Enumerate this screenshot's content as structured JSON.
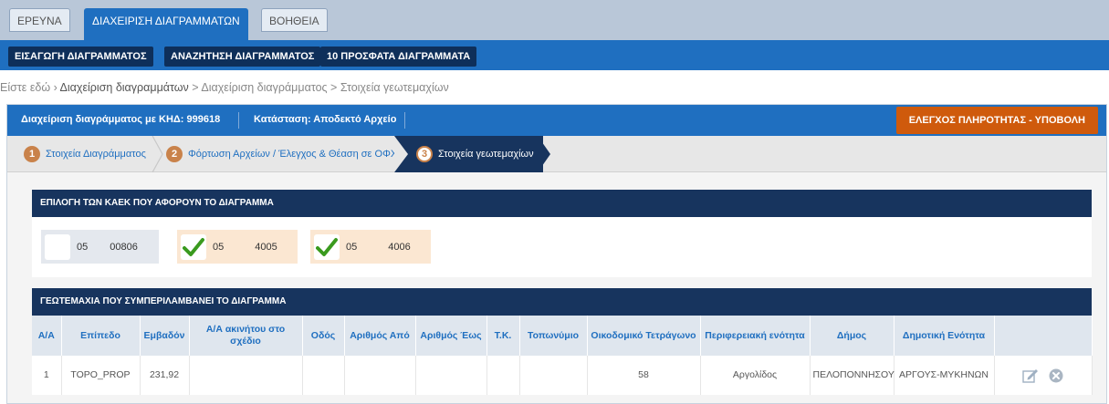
{
  "main_tabs": [
    {
      "label": "ΕΡΕΥΝΑ",
      "active": false
    },
    {
      "label": "ΔΙΑΧΕΙΡΙΣΗ ΔΙΑΓΡΑΜΜΑΤΩΝ",
      "active": true
    },
    {
      "label": "ΒΟΗΘΕΙΑ",
      "active": false
    }
  ],
  "sub_nav": [
    {
      "label": "ΕΙΣΑΓΩΓΗ ΔΙΑΓΡΑΜΜΑΤΟΣ"
    },
    {
      "label": "ΑΝΑΖΗΤΗΣΗ ΔΙΑΓΡΑΜΜΑΤΟΣ"
    },
    {
      "label": "10 ΠΡΟΣΦΑΤΑ ΔΙΑΓΡΑΜΜΑΤΑ"
    }
  ],
  "breadcrumb": {
    "prefix": "Είστε εδώ › ",
    "item1": "Διαχείριση διαγραμμάτων",
    "sep": " > ",
    "item2": "Διαχείριση διαγράμματος",
    "item3": "Στοιχεία γεωτεμαχίων"
  },
  "info": {
    "diagram": "Διαχείριση διαγράμματος με ΚΗΔ: 999618",
    "status": "Κατάσταση: Αποδεκτό Αρχείο",
    "submit_label": "ΕΛΕΓΧΟΣ ΠΛΗΡΟΤΗΤΑΣ - ΥΠΟΒΟΛΗ"
  },
  "steps": [
    {
      "num": "1",
      "label": "Στοιχεία Διαγράμματος"
    },
    {
      "num": "2",
      "label": "Φόρτωση Αρχείων / Έλεγχος & Θέαση σε ΟΦΧ"
    },
    {
      "num": "3",
      "label": "Στοιχεία γεωτεμαχίων"
    }
  ],
  "kaek_section": {
    "title": "ΕΠΙΛΟΓΗ ΤΩΝ ΚΑΕΚ ΠΟΥ ΑΦΟΡΟΥΝ ΤΟ ΔΙΑΓΡΑΜΜΑ",
    "items": [
      {
        "prefix": "05",
        "suffix": "00806",
        "checked": false
      },
      {
        "prefix": "05",
        "suffix": "4005",
        "checked": true
      },
      {
        "prefix": "05",
        "suffix": "4006",
        "checked": true
      }
    ]
  },
  "parcels_section": {
    "title": "ΓΕΩΤΕΜΑΧΙΑ ΠΟΥ ΣΥΜΠΕΡΙΛΑΜΒΑΝΕΙ ΤΟ ΔΙΑΓΡΑΜΜΑ",
    "columns": [
      "Α/Α",
      "Επίπεδο",
      "Εμβαδόν",
      "Α/Α ακινήτου στο σχέδιο",
      "Οδός",
      "Αριθμός Από",
      "Αριθμός Έως",
      "Τ.Κ.",
      "Τοπωνύμιο",
      "Οικοδομικό Τετράγωνο",
      "Περιφερειακή ενότητα",
      "Δήμος",
      "Δημοτική Ενότητα",
      ""
    ],
    "rows": [
      [
        "1",
        "TOPO_PROP",
        "231,92",
        "",
        "",
        "",
        "",
        "",
        "",
        "58",
        "Αργολίδος",
        "ΠΕΛΟΠΟΝΝΗΣΟΥ",
        "ΑΡΓΟΥΣ-ΜΥΚΗΝΩΝ"
      ]
    ]
  },
  "icons": {
    "edit": "edit-icon",
    "delete": "delete-icon",
    "check": "checkmark-icon"
  },
  "colors": {
    "primary": "#1f6fc0",
    "dark": "#17345e",
    "accent": "#cf5a0c"
  }
}
